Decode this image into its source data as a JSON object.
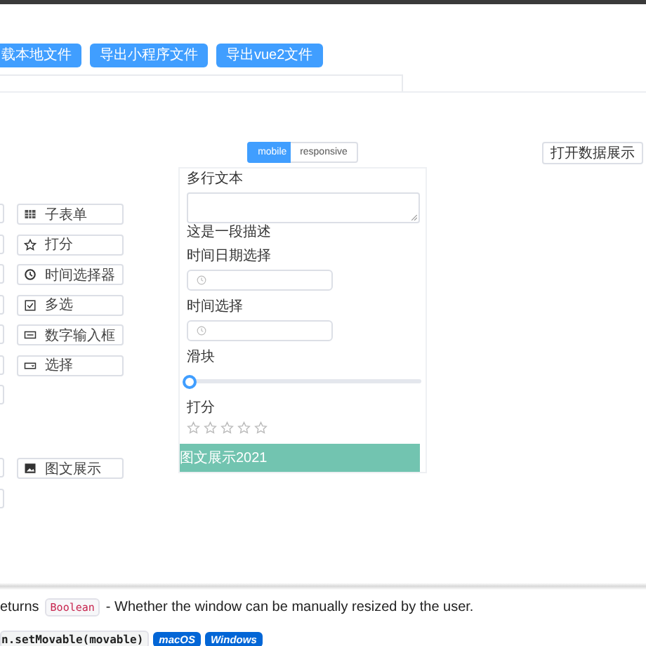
{
  "toolbar": {
    "buttons": [
      "载本地文件",
      "导出小程序文件",
      "导出vue2文件"
    ]
  },
  "palette": {
    "groups": [
      {
        "rows": [
          {
            "item": {
              "label": "子表单",
              "kind": "subform"
            }
          },
          {
            "item": {
              "label": "打分",
              "kind": "rate"
            }
          },
          {
            "item": {
              "label": "时间选择器",
              "kind": "time"
            }
          },
          {
            "item": {
              "label": "多选",
              "kind": "checkbox"
            }
          },
          {
            "item": {
              "label": "数字输入框",
              "kind": "number"
            }
          },
          {
            "item": {
              "label": "选择",
              "kind": "select"
            }
          },
          {}
        ]
      },
      {
        "rows": [
          {
            "item": {
              "label": "图文展示",
              "kind": "image-text"
            }
          },
          {}
        ]
      }
    ]
  },
  "view_toggle": [
    {
      "label": "mobile",
      "selected": true
    },
    {
      "label": "responsive",
      "selected": false
    }
  ],
  "data_button": "打开数据展示",
  "form": {
    "fields": [
      {
        "kind": "textarea",
        "label": "多行文本"
      },
      {
        "kind": "description",
        "text": "这是一段描述"
      },
      {
        "kind": "datetime",
        "label": "时间日期选择"
      },
      {
        "kind": "time",
        "label": "时间选择"
      },
      {
        "kind": "slider",
        "label": "滑块",
        "level": 0
      },
      {
        "kind": "rate",
        "label": "打分",
        "stars": 0
      },
      {
        "kind": "banner",
        "text": "图文展示2021"
      }
    ]
  },
  "doc": {
    "returns_prefix": "eturns",
    "returns_type": "Boolean",
    "returns_text": "- Whether the window can be manually resized by the user.",
    "method": "n.setMovable(movable)",
    "platforms": [
      "macOS",
      "Windows"
    ]
  }
}
